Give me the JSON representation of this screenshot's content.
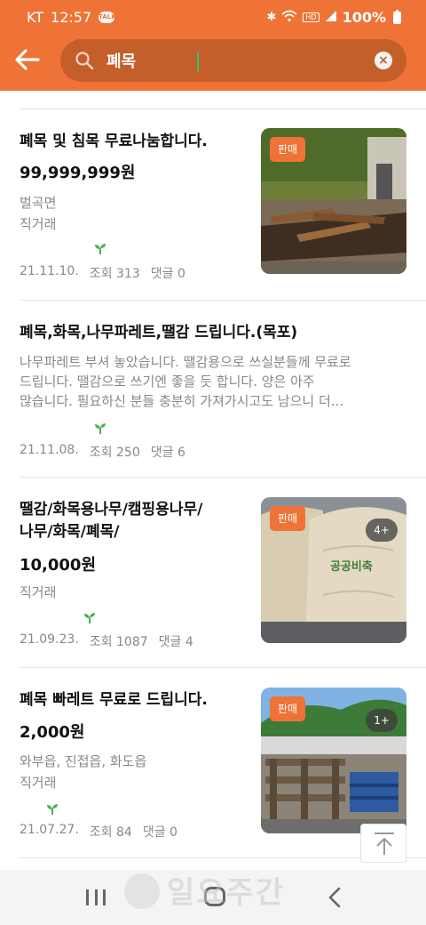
{
  "status_bar": {
    "carrier": "KT",
    "time": "12:57",
    "notification": "TALK",
    "hd": "HD",
    "battery": "100%"
  },
  "search": {
    "query": "폐목"
  },
  "items": [
    {
      "title": "폐목 및 침목 무료나눔합니다.",
      "price": "99,999,999원",
      "location": "벌곡면",
      "trade": "직거래",
      "date": "21.11.10.",
      "views": "조회 313",
      "comments": "댓글 0",
      "badge": "판매"
    },
    {
      "title": "폐목,화목,나무파레트,땔감 드립니다.(목포)",
      "desc_line1": "나무파레트 부셔 놓았습니다. 땔감용으로 쓰실분들께 무료로",
      "desc_line2": "드립니다. 땔감으로 쓰기엔 좋을 듯 합니다. 양은 아주",
      "desc_line3": "많습니다. 필요하신 분들 충분히 가져가시고도 남으니 더...",
      "date": "21.11.08.",
      "views": "조회 250",
      "comments": "댓글 6"
    },
    {
      "title_line1": "땔감/화목용나무/캠핑용나무/",
      "title_line2": "나무/화목/폐목/",
      "price": "10,000원",
      "trade": "직거래",
      "date": "21.09.23.",
      "views": "조회 1087",
      "comments": "댓글 4",
      "badge": "판매",
      "photo_count": "4+",
      "bag_text": "공공비축"
    },
    {
      "title": "폐목 빠레트 무료로 드립니다.",
      "price": "2,000원",
      "location": "와부읍, 진접읍, 화도읍",
      "trade": "직거래",
      "date": "21.07.27.",
      "views": "조회 84",
      "comments": "댓글 0",
      "badge": "판매",
      "photo_count": "1+"
    }
  ],
  "watermark": "일요주간",
  "colors": {
    "accent": "#ef7336",
    "search_bg": "#c45f2c",
    "sprout": "#4caf50"
  },
  "icons": [
    "back-arrow-icon",
    "search-icon",
    "clear-icon",
    "sprout-icon",
    "scroll-top-icon",
    "recent-apps-icon",
    "home-icon",
    "nav-back-icon"
  ]
}
